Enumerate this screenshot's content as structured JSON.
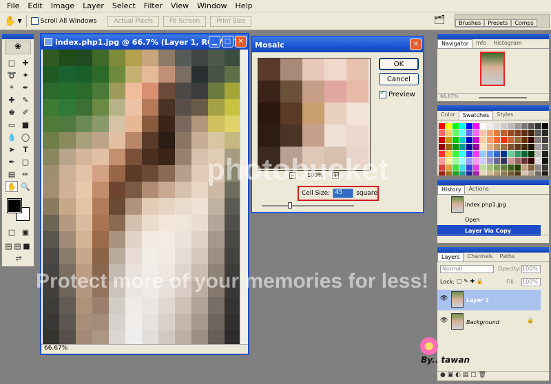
{
  "menu": [
    "File",
    "Edit",
    "Image",
    "Layer",
    "Select",
    "Filter",
    "View",
    "Window",
    "Help"
  ],
  "options_bar": {
    "scroll_all_label": "Scroll All Windows",
    "actual_pixels": "Actual Pixels",
    "fit_screen": "Fit Screen",
    "print_size": "Print Size"
  },
  "palette_well": {
    "tabs": [
      "Brushes",
      "Presets",
      "Comps"
    ]
  },
  "document": {
    "title": "index.php1.jpg @ 66.7% (Layer 1, RGB/8#)",
    "zoom": "66.67%",
    "colors": [
      [
        "#2f5a22",
        "#1e4d1a",
        "#204a20",
        "#3f6a2a",
        "#7c8a3a",
        "#b3a14e",
        "#c9a57e",
        "#8c7a66",
        "#565b57",
        "#3e4542",
        "#4c5a4a",
        "#3b4d3d"
      ],
      [
        "#1f5a25",
        "#1a6230",
        "#1a5f2a",
        "#2d6a2a",
        "#6e8a3a",
        "#c5b070",
        "#e4bb98",
        "#bf8f76",
        "#7a6e64",
        "#2a3031",
        "#465242",
        "#5d7048"
      ],
      [
        "#2a6a2c",
        "#246e2e",
        "#2a6a2a",
        "#4a7a3a",
        "#9e9a5a",
        "#eebe9c",
        "#d99070",
        "#6b4a3a",
        "#4c4846",
        "#3d3c3c",
        "#6a7a3e",
        "#a4a637"
      ],
      [
        "#3d7a34",
        "#2f7a36",
        "#3c7034",
        "#6a8a44",
        "#b6b388",
        "#eec2a4",
        "#b67a5a",
        "#4a3224",
        "#5a4e48",
        "#6a5a4a",
        "#a4a045",
        "#c8c242"
      ],
      [
        "#4f7a38",
        "#4e7a3f",
        "#6a8a55",
        "#8a9a6a",
        "#d6c2a4",
        "#e8b896",
        "#8a5a3c",
        "#3a2418",
        "#7a685c",
        "#b0967a",
        "#d0c060",
        "#e0d36a"
      ],
      [
        "#6e7e48",
        "#8a8a5e",
        "#a8a07a",
        "#bda488",
        "#e4c0a2",
        "#ba866a",
        "#5a3a28",
        "#2c1c14",
        "#8a7464",
        "#c8ae96",
        "#d8c6a0",
        "#c4b880"
      ],
      [
        "#8a8660",
        "#b8a48a",
        "#d6b69a",
        "#e2c0a4",
        "#c48e70",
        "#7a5038",
        "#4a2e20",
        "#3a2418",
        "#9a8070",
        "#d8c2ae",
        "#e0cdb6",
        "#a89c80"
      ],
      [
        "#9e906e",
        "#cdb095",
        "#e4c2a6",
        "#d3a284",
        "#9a6648",
        "#5c3a28",
        "#6a4a36",
        "#8a6a56",
        "#b89e8c",
        "#e2ccb8",
        "#dcc6b0",
        "#8a8670"
      ],
      [
        "#a48e70",
        "#d2b296",
        "#e8c8aa",
        "#c08c6c",
        "#6e4630",
        "#7a5a44",
        "#b08c74",
        "#c8a890",
        "#d6c0ae",
        "#ead6c4",
        "#cdb9a6",
        "#6e6e5e"
      ],
      [
        "#8a7a60",
        "#c8a88a",
        "#e4c4a6",
        "#b07c5c",
        "#6a4a34",
        "#b0947c",
        "#e4ccb6",
        "#e8d4c2",
        "#ecdcce",
        "#f0e2d6",
        "#c2b2a2",
        "#5a5a52"
      ],
      [
        "#6e6454",
        "#b49a80",
        "#dcbca0",
        "#a87452",
        "#8a6a52",
        "#d4c0ae",
        "#ecdccc",
        "#f2e6dc",
        "#f0e6dc",
        "#eadcd0",
        "#b4a698",
        "#4e4e4a"
      ],
      [
        "#5a564e",
        "#a08c76",
        "#d4b496",
        "#9c6a4a",
        "#a8947e",
        "#e0d4c8",
        "#f2eae2",
        "#f4ece4",
        "#ece2da",
        "#e0d2c6",
        "#a8988c",
        "#484846"
      ],
      [
        "#4c4a46",
        "#8a7a6a",
        "#c8a88c",
        "#8c6448",
        "#b8aa9c",
        "#e6dcd4",
        "#f4eee8",
        "#f2eae4",
        "#e6dcd4",
        "#d6c8bc",
        "#9c8e84",
        "#44423e"
      ],
      [
        "#464440",
        "#7a6e62",
        "#bc9c82",
        "#8a6850",
        "#c4bab0",
        "#eae2dc",
        "#f2ece8",
        "#eee6e0",
        "#e0d6ce",
        "#cabcb0",
        "#908478",
        "#3e3c3a"
      ],
      [
        "#42403c",
        "#6e645a",
        "#b4967e",
        "#92745e",
        "#ccc4bc",
        "#ece6e2",
        "#eeeae6",
        "#e8e0da",
        "#d8ccc4",
        "#bcaea2",
        "#84786e",
        "#3a3836"
      ],
      [
        "#3e3c38",
        "#645c54",
        "#ae927a",
        "#9a806c",
        "#d2ccc6",
        "#eeeae8",
        "#eae6e2",
        "#e0d8d2",
        "#cec2b8",
        "#b0a296",
        "#786e66",
        "#363432"
      ],
      [
        "#3a3834",
        "#5c5650",
        "#a88e78",
        "#a48c7a",
        "#d6d2ce",
        "#efecea",
        "#e6e2de",
        "#d8d0ca",
        "#c4b8ae",
        "#a6988c",
        "#6e665e",
        "#32302e"
      ],
      [
        "#36342e",
        "#56504a",
        "#a48a76",
        "#ac9684",
        "#dad6d4",
        "#f0eeec",
        "#e2dedb",
        "#d0c8c2",
        "#bcb0a6",
        "#9c8e84",
        "#665e58",
        "#2e2c2a"
      ]
    ]
  },
  "dialog": {
    "title": "Mosaic",
    "ok": "OK",
    "cancel": "Cancel",
    "preview_label": "Preview",
    "zoom": "100%",
    "cell_size_label": "Cell Size:",
    "cell_size_value": "45",
    "unit": "square",
    "preview_colors": [
      [
        "#5a3a2a",
        "#a88a78",
        "#e8c8b8",
        "#f0d8cc",
        "#e8c4b0"
      ],
      [
        "#3a2418",
        "#6a5038",
        "#c8a08a",
        "#e0a8a0",
        "#e8b8a8"
      ],
      [
        "#2a1810",
        "#5a3a24",
        "#c8a070",
        "#e8d0c0",
        "#f4e4d8"
      ],
      [
        "#2c1c14",
        "#4a3428",
        "#c4a08c",
        "#f0e0d4",
        "#ecd8cc"
      ],
      [
        "#3a2a20",
        "#b8a090",
        "#e0c8b8",
        "#d8c0b0",
        "#e8d4c8"
      ]
    ]
  },
  "navigator": {
    "tabs": [
      "Navigator",
      "Info",
      "Histogram"
    ],
    "zoom": "66.67%"
  },
  "swatches": {
    "tabs": [
      "Color",
      "Swatches",
      "Styles"
    ],
    "colors": [
      "#ff0000",
      "#ffff00",
      "#00ff00",
      "#00ffff",
      "#0000ff",
      "#ff00ff",
      "#ffffff",
      "#eeeeee",
      "#dddddd",
      "#cccccc",
      "#bbbbbb",
      "#999999",
      "#777777",
      "#555555",
      "#333333",
      "#000000",
      "#ff6666",
      "#ffcc66",
      "#66ff66",
      "#66ffff",
      "#6666ff",
      "#ff66ff",
      "#f4c5a5",
      "#f0a070",
      "#e08040",
      "#c06030",
      "#a04820",
      "#804020",
      "#603018",
      "#402010",
      "#5a5a5a",
      "#2a2a2a",
      "#cc0000",
      "#cc9900",
      "#00cc00",
      "#00cccc",
      "#0000cc",
      "#cc00cc",
      "#ffcc99",
      "#ff9966",
      "#ff6633",
      "#ff3300",
      "#cc6633",
      "#996633",
      "#663300",
      "#330000",
      "#808080",
      "#404040",
      "#990000",
      "#996600",
      "#009900",
      "#009999",
      "#000099",
      "#990099",
      "#ffe0c0",
      "#e0b090",
      "#c09060",
      "#a07040",
      "#805030",
      "#603820",
      "#402810",
      "#201008",
      "#a0a0a0",
      "#606060",
      "#ff3333",
      "#ffcc33",
      "#33ff33",
      "#33ffff",
      "#3333ff",
      "#ff33ff",
      "#99ccff",
      "#6699ff",
      "#3366cc",
      "#003399",
      "#66cc99",
      "#339966",
      "#006633",
      "#003300",
      "#c0c0c0",
      "#202020",
      "#ff9999",
      "#ffee99",
      "#99ff99",
      "#99ffff",
      "#9999ff",
      "#ff99ff",
      "#ccccff",
      "#9999cc",
      "#666699",
      "#333366",
      "#cc9999",
      "#996666",
      "#663333",
      "#330000",
      "#e0e0e0",
      "#101010",
      "#e04040",
      "#e0a040",
      "#40e040",
      "#40e0e0",
      "#4040e0",
      "#e040e0",
      "#c0e0a0",
      "#a0c080",
      "#80a060",
      "#608040",
      "#406020",
      "#204000",
      "#c0a080",
      "#806040",
      "#8a8a8a",
      "#3a3a3a",
      "#a02020",
      "#a07020",
      "#20a020",
      "#20a0a0",
      "#2020a0",
      "#a020a0",
      "#e8d8b8",
      "#d0b890",
      "#b09870",
      "#907850",
      "#705830",
      "#503810",
      "#d0c0b0",
      "#b0a090",
      "#6a6a6a",
      "#1a1a1a"
    ]
  },
  "history": {
    "tabs": [
      "History",
      "Actions"
    ],
    "snapshot": "index.php1.jpg",
    "items": [
      "Open",
      "Layer Via Copy"
    ]
  },
  "layers": {
    "tabs": [
      "Layers",
      "Channels",
      "Paths"
    ],
    "blend_mode": "Normal",
    "opacity_label": "Opacity:",
    "opacity_value": "100%",
    "lock_label": "Lock:",
    "fill_label": "Fill:",
    "fill_value": "100%",
    "items": [
      "Layer 1",
      "Background"
    ]
  },
  "watermark": {
    "brand": "photobucket",
    "line": "Protect more of your memories for less!"
  },
  "signature": "By.. tawan"
}
